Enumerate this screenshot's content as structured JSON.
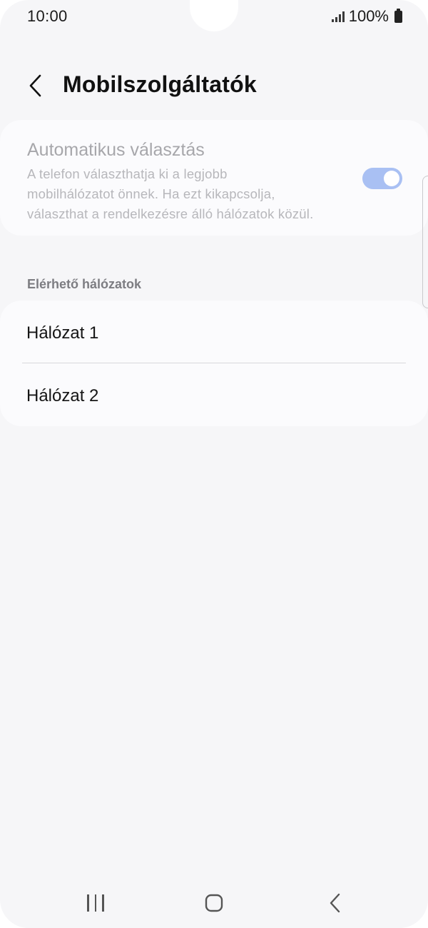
{
  "status_bar": {
    "time": "10:00",
    "battery": "100%",
    "icons": [
      "signal-icon",
      "battery-icon"
    ]
  },
  "header": {
    "title": "Mobilszolgáltatók",
    "back_icon": "chevron-left-icon"
  },
  "auto_select": {
    "title": "Automatikus választás",
    "description_lines": [
      "A telefon választhatja ki a legjobb",
      "mobilhálózatot önnek. Ha ezt kikapcsolja,",
      "választhat a rendelkezésre álló hálózatok közül."
    ],
    "toggle_on": true,
    "disabled": true
  },
  "networks": {
    "section_label": "Elérhető hálózatok",
    "items": [
      {
        "label": "Hálózat 1"
      },
      {
        "label": "Hálózat 2"
      }
    ]
  },
  "nav_bar": {
    "icons": [
      "recents-icon",
      "home-icon",
      "back-icon"
    ]
  },
  "colors": {
    "background": "#f6f6f8",
    "card": "#fbfbfd",
    "toggle_track": "#a9c0f3",
    "disabled_text": "#a7a7ab"
  }
}
